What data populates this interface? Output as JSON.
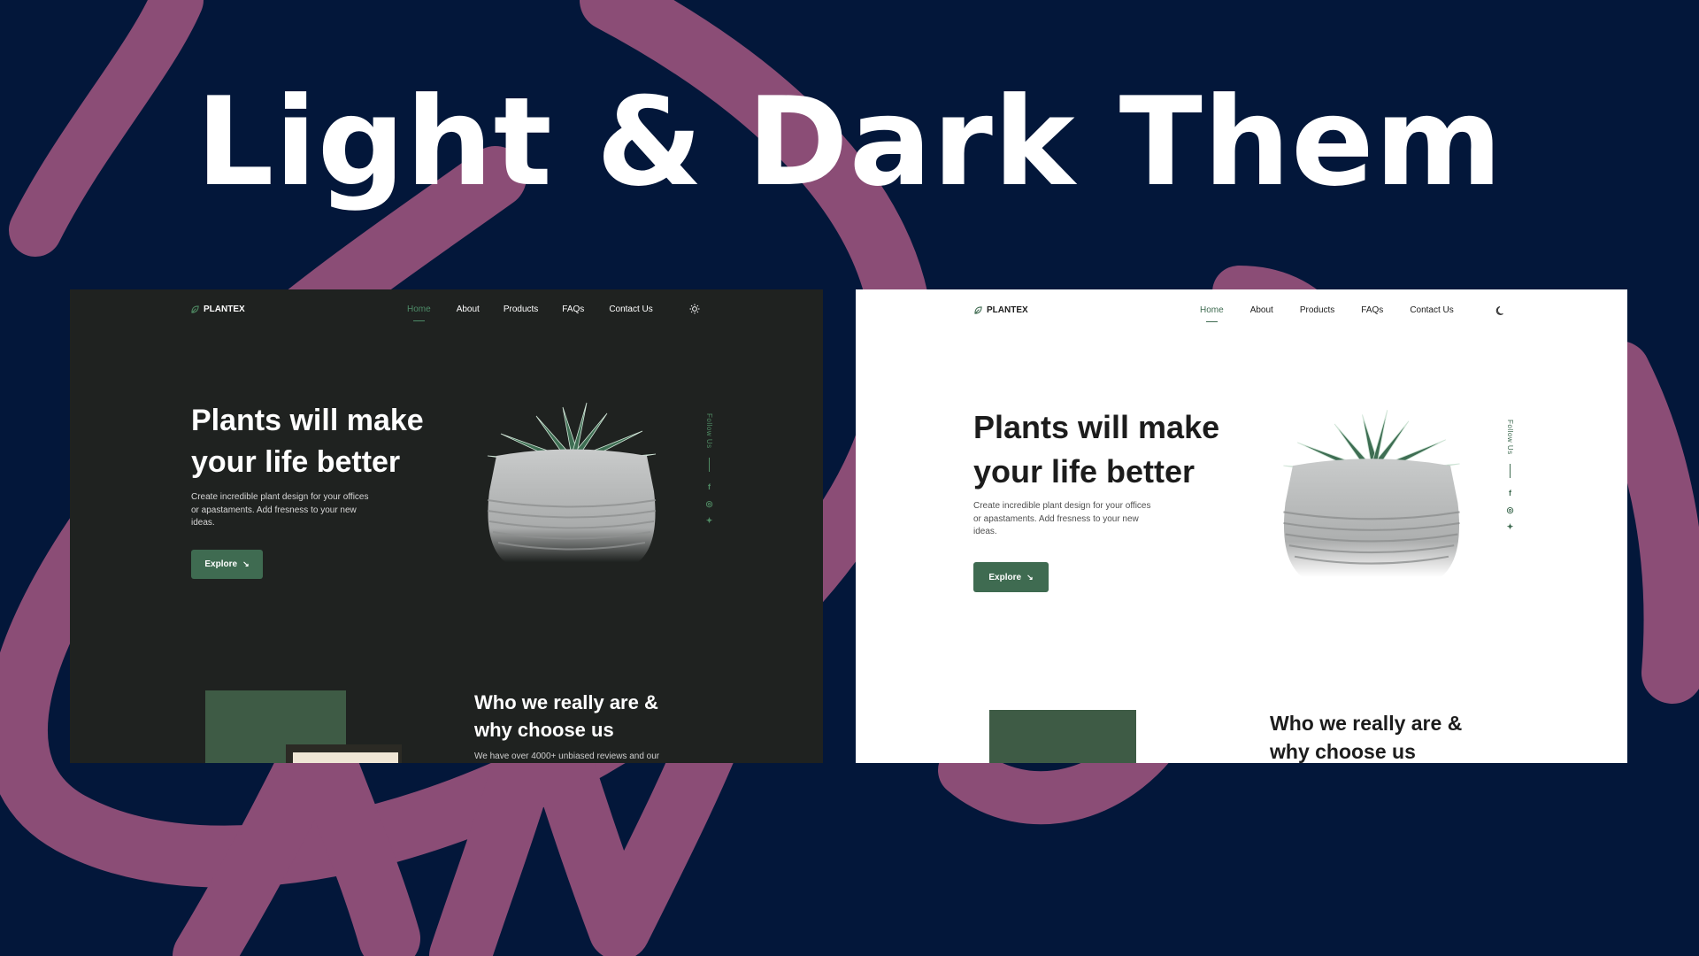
{
  "headline": "Light & Dark Them",
  "colors": {
    "page_background": "#03173a",
    "swirl": "#8b4d76",
    "dark_panel_bg": "#1f2220",
    "light_panel_bg": "#ffffff",
    "accent_green": "#3f6b51"
  },
  "dark": {
    "brand": "PLANTEX",
    "nav": [
      "Home",
      "About",
      "Products",
      "FAQs",
      "Contact Us"
    ],
    "theme_toggle_icon": "sun-icon",
    "hero_title_line1": "Plants will make",
    "hero_title_line2": "your life better",
    "hero_desc_line1": "Create incredible plant design for your offices",
    "hero_desc_line2": "or apastaments. Add fresness to your new",
    "hero_desc_line3": "ideas.",
    "explore_label": "Explore",
    "follow_label": "Follow Us",
    "socials": [
      "facebook-icon",
      "instagram-icon",
      "twitter-icon"
    ],
    "about_title_line1": "Who we really are &",
    "about_title_line2": "why choose us",
    "about_text": "We have over 4000+ unbiased reviews and our"
  },
  "light": {
    "brand": "PLANTEX",
    "nav": [
      "Home",
      "About",
      "Products",
      "FAQs",
      "Contact Us"
    ],
    "theme_toggle_icon": "moon-icon",
    "hero_title_line1": "Plants will make",
    "hero_title_line2": "your life better",
    "hero_desc_line1": "Create incredible plant design for your offices",
    "hero_desc_line2": "or apastaments. Add fresness to your new",
    "hero_desc_line3": "ideas.",
    "explore_label": "Explore",
    "follow_label": "Follow Us",
    "socials": [
      "facebook-icon",
      "instagram-icon",
      "twitter-icon"
    ],
    "about_title_line1": "Who we really are &",
    "about_title_line2": "why choose us"
  }
}
